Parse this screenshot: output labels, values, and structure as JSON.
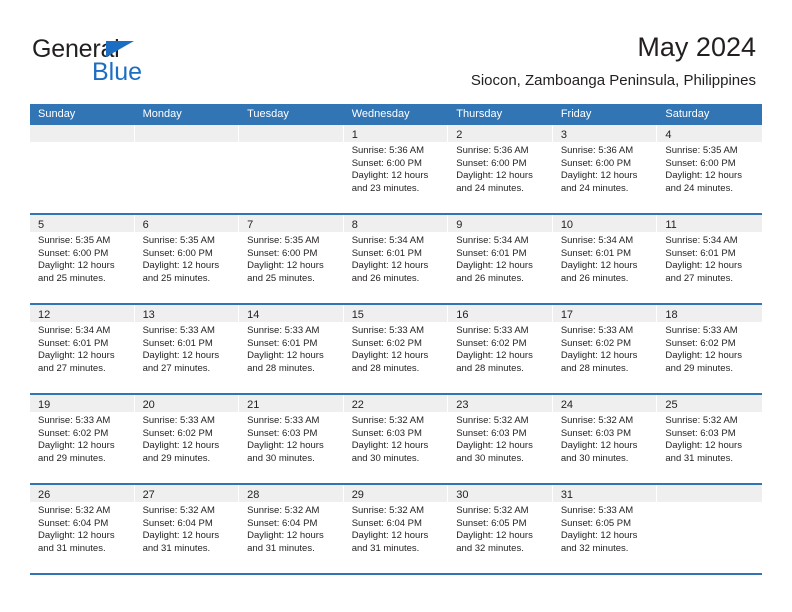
{
  "brand": {
    "name_part1": "General",
    "name_part2": "Blue",
    "triangle_icon": "triangle-icon",
    "accent_color": "#1b6ec2"
  },
  "header": {
    "title": "May 2024",
    "subtitle": "Siocon, Zamboanga Peninsula, Philippines"
  },
  "theme": {
    "header_blue": "#3175b4",
    "banner_gray": "#efefef",
    "text_color": "#231f20"
  },
  "calendar": {
    "weekdays": [
      "Sunday",
      "Monday",
      "Tuesday",
      "Wednesday",
      "Thursday",
      "Friday",
      "Saturday"
    ],
    "weeks": [
      [
        {
          "day": "",
          "lines": []
        },
        {
          "day": "",
          "lines": []
        },
        {
          "day": "",
          "lines": []
        },
        {
          "day": "1",
          "lines": [
            "Sunrise: 5:36 AM",
            "Sunset: 6:00 PM",
            "Daylight: 12 hours",
            "and 23 minutes."
          ]
        },
        {
          "day": "2",
          "lines": [
            "Sunrise: 5:36 AM",
            "Sunset: 6:00 PM",
            "Daylight: 12 hours",
            "and 24 minutes."
          ]
        },
        {
          "day": "3",
          "lines": [
            "Sunrise: 5:36 AM",
            "Sunset: 6:00 PM",
            "Daylight: 12 hours",
            "and 24 minutes."
          ]
        },
        {
          "day": "4",
          "lines": [
            "Sunrise: 5:35 AM",
            "Sunset: 6:00 PM",
            "Daylight: 12 hours",
            "and 24 minutes."
          ]
        }
      ],
      [
        {
          "day": "5",
          "lines": [
            "Sunrise: 5:35 AM",
            "Sunset: 6:00 PM",
            "Daylight: 12 hours",
            "and 25 minutes."
          ]
        },
        {
          "day": "6",
          "lines": [
            "Sunrise: 5:35 AM",
            "Sunset: 6:00 PM",
            "Daylight: 12 hours",
            "and 25 minutes."
          ]
        },
        {
          "day": "7",
          "lines": [
            "Sunrise: 5:35 AM",
            "Sunset: 6:00 PM",
            "Daylight: 12 hours",
            "and 25 minutes."
          ]
        },
        {
          "day": "8",
          "lines": [
            "Sunrise: 5:34 AM",
            "Sunset: 6:01 PM",
            "Daylight: 12 hours",
            "and 26 minutes."
          ]
        },
        {
          "day": "9",
          "lines": [
            "Sunrise: 5:34 AM",
            "Sunset: 6:01 PM",
            "Daylight: 12 hours",
            "and 26 minutes."
          ]
        },
        {
          "day": "10",
          "lines": [
            "Sunrise: 5:34 AM",
            "Sunset: 6:01 PM",
            "Daylight: 12 hours",
            "and 26 minutes."
          ]
        },
        {
          "day": "11",
          "lines": [
            "Sunrise: 5:34 AM",
            "Sunset: 6:01 PM",
            "Daylight: 12 hours",
            "and 27 minutes."
          ]
        }
      ],
      [
        {
          "day": "12",
          "lines": [
            "Sunrise: 5:34 AM",
            "Sunset: 6:01 PM",
            "Daylight: 12 hours",
            "and 27 minutes."
          ]
        },
        {
          "day": "13",
          "lines": [
            "Sunrise: 5:33 AM",
            "Sunset: 6:01 PM",
            "Daylight: 12 hours",
            "and 27 minutes."
          ]
        },
        {
          "day": "14",
          "lines": [
            "Sunrise: 5:33 AM",
            "Sunset: 6:01 PM",
            "Daylight: 12 hours",
            "and 28 minutes."
          ]
        },
        {
          "day": "15",
          "lines": [
            "Sunrise: 5:33 AM",
            "Sunset: 6:02 PM",
            "Daylight: 12 hours",
            "and 28 minutes."
          ]
        },
        {
          "day": "16",
          "lines": [
            "Sunrise: 5:33 AM",
            "Sunset: 6:02 PM",
            "Daylight: 12 hours",
            "and 28 minutes."
          ]
        },
        {
          "day": "17",
          "lines": [
            "Sunrise: 5:33 AM",
            "Sunset: 6:02 PM",
            "Daylight: 12 hours",
            "and 28 minutes."
          ]
        },
        {
          "day": "18",
          "lines": [
            "Sunrise: 5:33 AM",
            "Sunset: 6:02 PM",
            "Daylight: 12 hours",
            "and 29 minutes."
          ]
        }
      ],
      [
        {
          "day": "19",
          "lines": [
            "Sunrise: 5:33 AM",
            "Sunset: 6:02 PM",
            "Daylight: 12 hours",
            "and 29 minutes."
          ]
        },
        {
          "day": "20",
          "lines": [
            "Sunrise: 5:33 AM",
            "Sunset: 6:02 PM",
            "Daylight: 12 hours",
            "and 29 minutes."
          ]
        },
        {
          "day": "21",
          "lines": [
            "Sunrise: 5:33 AM",
            "Sunset: 6:03 PM",
            "Daylight: 12 hours",
            "and 30 minutes."
          ]
        },
        {
          "day": "22",
          "lines": [
            "Sunrise: 5:32 AM",
            "Sunset: 6:03 PM",
            "Daylight: 12 hours",
            "and 30 minutes."
          ]
        },
        {
          "day": "23",
          "lines": [
            "Sunrise: 5:32 AM",
            "Sunset: 6:03 PM",
            "Daylight: 12 hours",
            "and 30 minutes."
          ]
        },
        {
          "day": "24",
          "lines": [
            "Sunrise: 5:32 AM",
            "Sunset: 6:03 PM",
            "Daylight: 12 hours",
            "and 30 minutes."
          ]
        },
        {
          "day": "25",
          "lines": [
            "Sunrise: 5:32 AM",
            "Sunset: 6:03 PM",
            "Daylight: 12 hours",
            "and 31 minutes."
          ]
        }
      ],
      [
        {
          "day": "26",
          "lines": [
            "Sunrise: 5:32 AM",
            "Sunset: 6:04 PM",
            "Daylight: 12 hours",
            "and 31 minutes."
          ]
        },
        {
          "day": "27",
          "lines": [
            "Sunrise: 5:32 AM",
            "Sunset: 6:04 PM",
            "Daylight: 12 hours",
            "and 31 minutes."
          ]
        },
        {
          "day": "28",
          "lines": [
            "Sunrise: 5:32 AM",
            "Sunset: 6:04 PM",
            "Daylight: 12 hours",
            "and 31 minutes."
          ]
        },
        {
          "day": "29",
          "lines": [
            "Sunrise: 5:32 AM",
            "Sunset: 6:04 PM",
            "Daylight: 12 hours",
            "and 31 minutes."
          ]
        },
        {
          "day": "30",
          "lines": [
            "Sunrise: 5:32 AM",
            "Sunset: 6:05 PM",
            "Daylight: 12 hours",
            "and 32 minutes."
          ]
        },
        {
          "day": "31",
          "lines": [
            "Sunrise: 5:33 AM",
            "Sunset: 6:05 PM",
            "Daylight: 12 hours",
            "and 32 minutes."
          ]
        },
        {
          "day": "",
          "lines": []
        }
      ]
    ]
  }
}
